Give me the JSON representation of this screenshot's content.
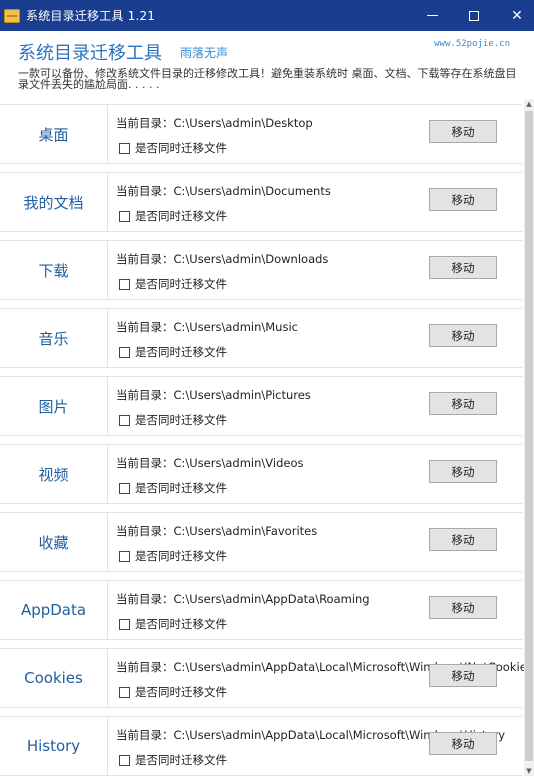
{
  "window": {
    "title": "系统目录迁移工具 1.21",
    "controls": {
      "minimize": "minimize",
      "maximize": "maximize",
      "close": "✕"
    }
  },
  "header": {
    "title": "系统目录迁移工具",
    "subtitle": "雨落无声",
    "site": "www.52pojie.cn",
    "description": "一款可以备份、修改系统文件目录的迁移修改工具！避免重装系统时 桌面、文档、下载等存在系统盘目录文件丢失的尴尬局面. . . . ."
  },
  "rows": [
    {
      "label": "桌面",
      "path": "当前目录：C:\\Users\\admin\\Desktop",
      "checkbox_label": "是否同时迁移文件",
      "checked": false,
      "button": "移动"
    },
    {
      "label": "我的文档",
      "path": "当前目录：C:\\Users\\admin\\Documents",
      "checkbox_label": "是否同时迁移文件",
      "checked": false,
      "button": "移动"
    },
    {
      "label": "下载",
      "path": "当前目录：C:\\Users\\admin\\Downloads",
      "checkbox_label": "是否同时迁移文件",
      "checked": false,
      "button": "移动"
    },
    {
      "label": "音乐",
      "path": "当前目录：C:\\Users\\admin\\Music",
      "checkbox_label": "是否同时迁移文件",
      "checked": false,
      "button": "移动"
    },
    {
      "label": "图片",
      "path": "当前目录：C:\\Users\\admin\\Pictures",
      "checkbox_label": "是否同时迁移文件",
      "checked": false,
      "button": "移动"
    },
    {
      "label": "视频",
      "path": "当前目录：C:\\Users\\admin\\Videos",
      "checkbox_label": "是否同时迁移文件",
      "checked": false,
      "button": "移动"
    },
    {
      "label": "收藏",
      "path": "当前目录：C:\\Users\\admin\\Favorites",
      "checkbox_label": "是否同时迁移文件",
      "checked": false,
      "button": "移动"
    },
    {
      "label": "AppData",
      "path": "当前目录：C:\\Users\\admin\\AppData\\Roaming",
      "checkbox_label": "是否同时迁移文件",
      "checked": false,
      "button": "移动"
    },
    {
      "label": "Cookies",
      "path": "当前目录：C:\\Users\\admin\\AppData\\Local\\Microsoft\\Windows\\INetCookies",
      "checkbox_label": "是否同时迁移文件",
      "checked": false,
      "button": "移动"
    },
    {
      "label": "History",
      "path": "当前目录：C:\\Users\\admin\\AppData\\Local\\Microsoft\\Windows\\History",
      "checkbox_label": "是否同时迁移文件",
      "checked": false,
      "button": "移动"
    }
  ],
  "colors": {
    "titlebar": "#1b3d8f",
    "accent": "#2b73c0",
    "label": "#1f5f9e"
  }
}
